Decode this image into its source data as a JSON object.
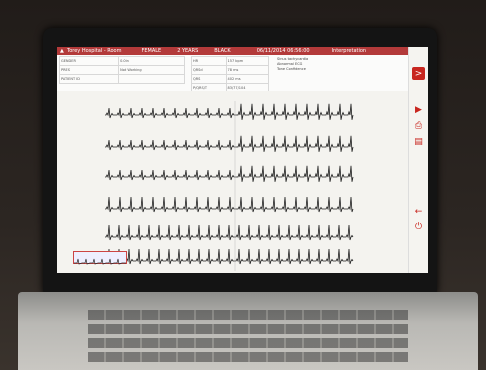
{
  "window": {
    "title": "Torey Hospital - Room"
  },
  "header": {
    "patient_label": "Torey Hospital - Room",
    "sex": "FEMALE",
    "age": "2 YEARS",
    "race": "BLACK",
    "datetime": "06/11/2014 06:56:00",
    "interpretation_title": "Interpretation"
  },
  "patient_fields": [
    {
      "label": "GENDER",
      "value": "0.0in"
    },
    {
      "label": "PRES",
      "value": "Not Working"
    },
    {
      "label": "PATIENT ID",
      "value": ""
    }
  ],
  "measurements": [
    {
      "label": "HR",
      "value": "157 bpm"
    },
    {
      "label": "QRSd",
      "value": "78 ms"
    },
    {
      "label": "QRS",
      "value": "402 ms"
    },
    {
      "label": "P/QRS/T",
      "value": "83/77/104"
    },
    {
      "label": "QTcB",
      "value": "..."
    }
  ],
  "interpretation": [
    "Sinus tachycardia",
    "Abnormal ECG",
    "Tone Confidence"
  ],
  "sidebar": {
    "buttons": [
      {
        "name": "forward-button",
        "glyph": ">"
      },
      {
        "name": "next-icon",
        "glyph": "▶"
      },
      {
        "name": "print-icon",
        "glyph": "⎙"
      },
      {
        "name": "document-icon",
        "glyph": "▤"
      },
      {
        "name": "back-arrow-icon",
        "glyph": "←"
      },
      {
        "name": "power-icon",
        "glyph": "⏻"
      }
    ]
  },
  "colors": {
    "header": "#b33a3a",
    "trace": "#1f1f1f",
    "accent": "#c8261f"
  }
}
